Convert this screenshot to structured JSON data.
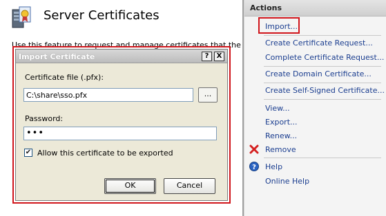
{
  "main": {
    "title": "Server Certificates",
    "description": "Use this feature to request and manage certificates that the"
  },
  "actions": {
    "header": "Actions",
    "items": [
      {
        "label": "Import...",
        "icon": ""
      },
      {
        "label": "Create Certificate Request...",
        "icon": ""
      },
      {
        "label": "Complete Certificate Request...",
        "icon": ""
      },
      {
        "label": "Create Domain Certificate...",
        "icon": ""
      },
      {
        "label": "Create Self-Signed Certificate...",
        "icon": ""
      },
      {
        "label": "View...",
        "icon": ""
      },
      {
        "label": "Export...",
        "icon": ""
      },
      {
        "label": "Renew...",
        "icon": ""
      },
      {
        "label": "Remove",
        "icon": "remove-x-icon"
      },
      {
        "label": "Help",
        "icon": "help-icon"
      },
      {
        "label": "Online Help",
        "icon": ""
      }
    ]
  },
  "dialog": {
    "title": "Import Certificate",
    "help_button": "?",
    "close_button": "X",
    "cert_file_label": "Certificate file (.pfx):",
    "cert_file_value": "C:\\share\\sso.pfx",
    "browse_label": "...",
    "password_label": "Password:",
    "password_value": "•••",
    "export_checkbox_label": "Allow this certificate to be exported",
    "export_checked": true,
    "ok_label": "OK",
    "cancel_label": "Cancel"
  },
  "colors": {
    "highlight": "#d0141a",
    "link": "#1a3d8f",
    "dialog_bg": "#ece9d8"
  }
}
